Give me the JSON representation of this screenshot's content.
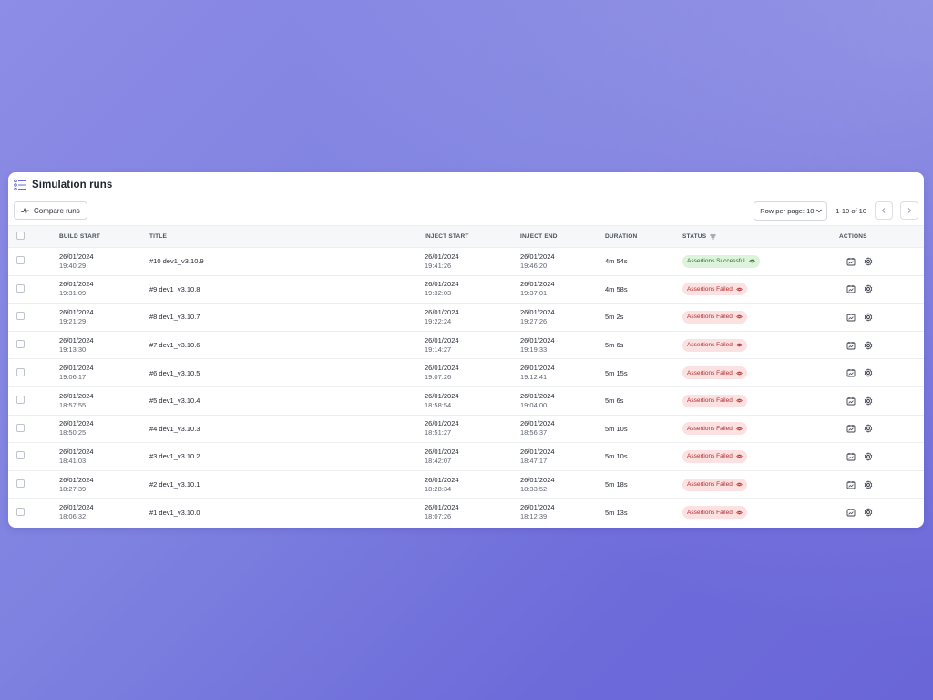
{
  "page": {
    "title": "Simulation runs"
  },
  "toolbar": {
    "compare_label": "Compare runs",
    "rows_per_page": "Row per page: 10",
    "range": "1-10 of 10"
  },
  "table": {
    "headers": {
      "build_start": "BUILD START",
      "title": "TITLE",
      "inject_start": "INJECT START",
      "inject_end": "INJECT END",
      "duration": "DURATION",
      "status": "STATUS",
      "actions": "ACTIONS"
    },
    "rows": [
      {
        "build_date": "26/01/2024",
        "build_time": "19:40:29",
        "title": "#10 dev1_v3.10.9",
        "inj_s_date": "26/01/2024",
        "inj_s_time": "19:41:26",
        "inj_e_date": "26/01/2024",
        "inj_e_time": "19:46:20",
        "duration": "4m 54s",
        "status": "Assertions Successful",
        "status_type": "ok"
      },
      {
        "build_date": "26/01/2024",
        "build_time": "19:31:09",
        "title": "#9 dev1_v3.10.8",
        "inj_s_date": "26/01/2024",
        "inj_s_time": "19:32:03",
        "inj_e_date": "26/01/2024",
        "inj_e_time": "19:37:01",
        "duration": "4m 58s",
        "status": "Assertions Failed",
        "status_type": "fail"
      },
      {
        "build_date": "26/01/2024",
        "build_time": "19:21:29",
        "title": "#8 dev1_v3.10.7",
        "inj_s_date": "26/01/2024",
        "inj_s_time": "19:22:24",
        "inj_e_date": "26/01/2024",
        "inj_e_time": "19:27:26",
        "duration": "5m 2s",
        "status": "Assertions Failed",
        "status_type": "fail"
      },
      {
        "build_date": "26/01/2024",
        "build_time": "19:13:30",
        "title": "#7 dev1_v3.10.6",
        "inj_s_date": "26/01/2024",
        "inj_s_time": "19:14:27",
        "inj_e_date": "26/01/2024",
        "inj_e_time": "19:19:33",
        "duration": "5m 6s",
        "status": "Assertions Failed",
        "status_type": "fail"
      },
      {
        "build_date": "26/01/2024",
        "build_time": "19:06:17",
        "title": "#6 dev1_v3.10.5",
        "inj_s_date": "26/01/2024",
        "inj_s_time": "19:07:26",
        "inj_e_date": "26/01/2024",
        "inj_e_time": "19:12:41",
        "duration": "5m 15s",
        "status": "Assertions Failed",
        "status_type": "fail"
      },
      {
        "build_date": "26/01/2024",
        "build_time": "18:57:55",
        "title": "#5 dev1_v3.10.4",
        "inj_s_date": "26/01/2024",
        "inj_s_time": "18:58:54",
        "inj_e_date": "26/01/2024",
        "inj_e_time": "19:04:00",
        "duration": "5m 6s",
        "status": "Assertions Failed",
        "status_type": "fail"
      },
      {
        "build_date": "26/01/2024",
        "build_time": "18:50:25",
        "title": "#4 dev1_v3.10.3",
        "inj_s_date": "26/01/2024",
        "inj_s_time": "18:51:27",
        "inj_e_date": "26/01/2024",
        "inj_e_time": "18:56:37",
        "duration": "5m 10s",
        "status": "Assertions Failed",
        "status_type": "fail"
      },
      {
        "build_date": "26/01/2024",
        "build_time": "18:41:03",
        "title": "#3 dev1_v3.10.2",
        "inj_s_date": "26/01/2024",
        "inj_s_time": "18:42:07",
        "inj_e_date": "26/01/2024",
        "inj_e_time": "18:47:17",
        "duration": "5m 10s",
        "status": "Assertions Failed",
        "status_type": "fail"
      },
      {
        "build_date": "26/01/2024",
        "build_time": "18:27:39",
        "title": "#2 dev1_v3.10.1",
        "inj_s_date": "26/01/2024",
        "inj_s_time": "18:28:34",
        "inj_e_date": "26/01/2024",
        "inj_e_time": "18:33:52",
        "duration": "5m 18s",
        "status": "Assertions Failed",
        "status_type": "fail"
      },
      {
        "build_date": "26/01/2024",
        "build_time": "18:06:32",
        "title": "#1 dev1_v3.10.0",
        "inj_s_date": "26/01/2024",
        "inj_s_time": "18:07:26",
        "inj_e_date": "26/01/2024",
        "inj_e_time": "18:12:39",
        "duration": "5m 13s",
        "status": "Assertions Failed",
        "status_type": "fail"
      }
    ]
  },
  "icons": {
    "title_icon": "list-icon",
    "compare_icon": "activity-icon",
    "status_filter_icon": "filter-icon",
    "status_badge_icon": "eye-icon",
    "action_icons": [
      "report-icon",
      "gear-icon"
    ],
    "pager_icons": [
      "chevron-left-icon",
      "chevron-right-icon"
    ]
  },
  "colors": {
    "accent": "#6c6ad9",
    "success_bg": "#ddf3dc",
    "success_text": "#2e6b2e",
    "fail_bg": "#fbe1e1",
    "fail_text": "#b3302e"
  }
}
